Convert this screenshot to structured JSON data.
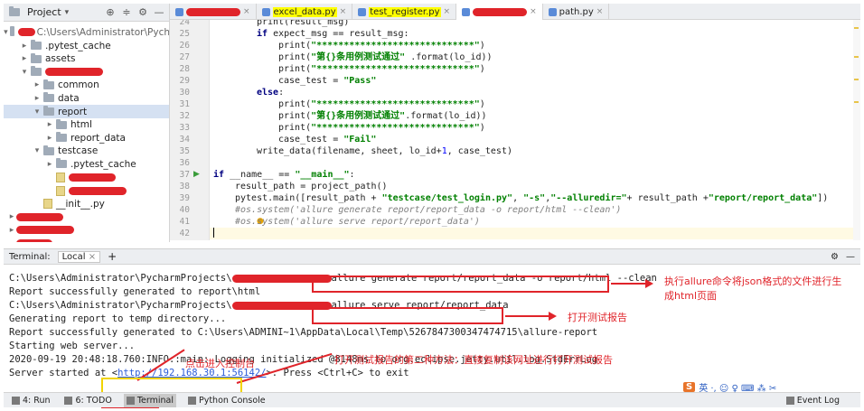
{
  "project_panel": {
    "title": "Project",
    "dropdown_glyph": "▾",
    "icons": [
      "target-icon",
      "collapse-icon",
      "gear-icon",
      "minimize-icon"
    ],
    "root_path": "C:\\Users\\Administrator\\Pych",
    "items": [
      {
        "label": ".pytest_cache",
        "indent": 1,
        "arrow": "▸",
        "icon": "folder"
      },
      {
        "label": "assets",
        "indent": 1,
        "arrow": "▸",
        "icon": "folder"
      },
      {
        "label": "",
        "indent": 1,
        "arrow": "▾",
        "icon": "folder",
        "redacted": true
      },
      {
        "label": "common",
        "indent": 2,
        "arrow": "▸",
        "icon": "folder"
      },
      {
        "label": "data",
        "indent": 2,
        "arrow": "▸",
        "icon": "folder"
      },
      {
        "label": "report",
        "indent": 2,
        "arrow": "▾",
        "icon": "folder",
        "selected": true
      },
      {
        "label": "html",
        "indent": 3,
        "arrow": "▸",
        "icon": "folder"
      },
      {
        "label": "report_data",
        "indent": 3,
        "arrow": "▸",
        "icon": "folder"
      },
      {
        "label": "testcase",
        "indent": 2,
        "arrow": "▾",
        "icon": "folder"
      },
      {
        "label": ".pytest_cache",
        "indent": 3,
        "arrow": "▸",
        "icon": "folder"
      },
      {
        "label": "",
        "indent": 3,
        "arrow": "",
        "icon": "file",
        "redacted": true
      },
      {
        "label": "",
        "indent": 3,
        "arrow": "",
        "icon": "file",
        "redacted": true
      },
      {
        "label": "__init__.py",
        "indent": 2,
        "arrow": "",
        "icon": "file"
      },
      {
        "label": "",
        "indent": 0,
        "arrow": "▸",
        "icon": "none",
        "redacted": true
      },
      {
        "label": "",
        "indent": 0,
        "arrow": "▸",
        "icon": "none",
        "redacted": true
      },
      {
        "label": "",
        "indent": 0,
        "arrow": "",
        "icon": "none",
        "redacted": true
      }
    ]
  },
  "editor_tabs": [
    {
      "label": "",
      "redacted": true,
      "active": false
    },
    {
      "label": "excel_data.py",
      "active": false,
      "highlight": true
    },
    {
      "label": "test_register.py",
      "active": false,
      "highlight": true
    },
    {
      "label": "",
      "redacted": true,
      "active": true
    },
    {
      "label": "path.py",
      "active": false
    }
  ],
  "code": {
    "first_line_number": 24,
    "current_line": 42,
    "run_marker_line": 37,
    "bulb_marker_line": 41,
    "lines": [
      {
        "indent": 8,
        "tokens": [
          {
            "t": "print(result_msg)",
            "c": ""
          }
        ]
      },
      {
        "indent": 8,
        "tokens": [
          {
            "t": "if",
            "c": "kw"
          },
          {
            "t": " expect_msg == result_msg:",
            "c": ""
          }
        ]
      },
      {
        "indent": 12,
        "tokens": [
          {
            "t": "print(",
            "c": ""
          },
          {
            "t": "\"*****************************\"",
            "c": "str"
          },
          {
            "t": ")",
            "c": ""
          }
        ]
      },
      {
        "indent": 12,
        "tokens": [
          {
            "t": "print(",
            "c": ""
          },
          {
            "t": "\"第{}条用例测试通过\"",
            "c": "str"
          },
          {
            "t": " .format(lo_id))",
            "c": ""
          }
        ]
      },
      {
        "indent": 12,
        "tokens": [
          {
            "t": "print(",
            "c": ""
          },
          {
            "t": "\"*****************************\"",
            "c": "str"
          },
          {
            "t": ")",
            "c": ""
          }
        ]
      },
      {
        "indent": 12,
        "tokens": [
          {
            "t": "case_test = ",
            "c": ""
          },
          {
            "t": "\"Pass\"",
            "c": "str"
          }
        ]
      },
      {
        "indent": 8,
        "tokens": [
          {
            "t": "else",
            "c": "kw"
          },
          {
            "t": ":",
            "c": ""
          }
        ]
      },
      {
        "indent": 12,
        "tokens": [
          {
            "t": "print(",
            "c": ""
          },
          {
            "t": "\"*****************************\"",
            "c": "str"
          },
          {
            "t": ")",
            "c": ""
          }
        ]
      },
      {
        "indent": 12,
        "tokens": [
          {
            "t": "print(",
            "c": ""
          },
          {
            "t": "\"第{}条用例测试通过\"",
            "c": "str"
          },
          {
            "t": ".format(lo_id))",
            "c": ""
          }
        ]
      },
      {
        "indent": 12,
        "tokens": [
          {
            "t": "print(",
            "c": ""
          },
          {
            "t": "\"*****************************\"",
            "c": "str"
          },
          {
            "t": ")",
            "c": ""
          }
        ]
      },
      {
        "indent": 12,
        "tokens": [
          {
            "t": "case_test = ",
            "c": ""
          },
          {
            "t": "\"Fail\"",
            "c": "str"
          }
        ]
      },
      {
        "indent": 8,
        "tokens": [
          {
            "t": "write_data(filename, sheet, lo_id+",
            "c": ""
          },
          {
            "t": "1",
            "c": "num"
          },
          {
            "t": ", case_test)",
            "c": ""
          }
        ]
      },
      {
        "indent": 0,
        "tokens": []
      },
      {
        "indent": 0,
        "tokens": [
          {
            "t": "if",
            "c": "kw"
          },
          {
            "t": " __name__ == ",
            "c": ""
          },
          {
            "t": "\"__main__\"",
            "c": "str"
          },
          {
            "t": ":",
            "c": ""
          }
        ]
      },
      {
        "indent": 4,
        "tokens": [
          {
            "t": "result_path = project_path()",
            "c": ""
          }
        ]
      },
      {
        "indent": 4,
        "tokens": [
          {
            "t": "pytest.main([result_path + ",
            "c": ""
          },
          {
            "t": "\"testcase/test_login.py\"",
            "c": "str"
          },
          {
            "t": ", ",
            "c": ""
          },
          {
            "t": "\"-s\"",
            "c": "str"
          },
          {
            "t": ",",
            "c": ""
          },
          {
            "t": "\"--alluredir=\"",
            "c": "str"
          },
          {
            "t": "+ result_path +",
            "c": ""
          },
          {
            "t": "\"report/report_data\"",
            "c": "str"
          },
          {
            "t": "])",
            "c": ""
          }
        ]
      },
      {
        "indent": 4,
        "tokens": [
          {
            "t": "#os.system('allure generate report/report_data -o report/html --clean')",
            "c": "com"
          }
        ]
      },
      {
        "indent": 4,
        "tokens": [
          {
            "t": "#os.system('allure serve report/report_data')",
            "c": "com"
          }
        ]
      },
      {
        "indent": 0,
        "tokens": []
      }
    ]
  },
  "terminal": {
    "tab_label": "Terminal:",
    "session_label": "Local",
    "close_glyph": "×",
    "add_glyph": "+",
    "settings_glyph": "⚙",
    "minimize_glyph": "—",
    "lines": [
      {
        "pre": "C:\\Users\\Administrator\\PycharmProjects\\",
        "redact_w": 110,
        "post": "allure generate report/report_data -o report/html --clean"
      },
      {
        "pre": "Report successfully generated to report\\html",
        "redact_w": 0,
        "post": ""
      },
      {
        "pre": "C:\\Users\\Administrator\\PycharmProjects\\",
        "redact_w": 110,
        "post": "allure serve report/report_data"
      },
      {
        "pre": "Generating report to temp directory...",
        "redact_w": 0,
        "post": ""
      },
      {
        "pre": "Report successfully generated to C:\\Users\\ADMINI~1\\AppData\\Local\\Temp\\5267847300347474715\\allure-report",
        "redact_w": 0,
        "post": ""
      },
      {
        "pre": "Starting web server...",
        "redact_w": 0,
        "post": ""
      },
      {
        "pre": "2020-09-19 20:48:18.760:INFO::main: Logging initialized @8148ms to org.eclipse.jetty.util.log.StdErrLog",
        "redact_w": 0,
        "post": ""
      },
      {
        "pre": "Server started at <",
        "link": "http://192.168.30.1:56142/",
        "post": ">. Press <Ctrl+C> to exit"
      }
    ]
  },
  "annotations": {
    "generate": "执行allure命令将json格式的文件进行生\n成html页面",
    "serve": "打开测试报告",
    "console": "点击进入控制台",
    "second_way": "打开测试报告的第二种方法：直接复制该网址进行打开测试报告"
  },
  "bottom_bar": {
    "items": [
      {
        "label": "4: Run",
        "active": false,
        "icon": "run-icon"
      },
      {
        "label": "6: TODO",
        "active": false,
        "icon": "todo-icon"
      },
      {
        "label": "Terminal",
        "active": true,
        "icon": "terminal-icon"
      },
      {
        "label": "Python Console",
        "active": false,
        "icon": "python-console-icon"
      }
    ],
    "event_log": "Event Log"
  },
  "ime_bar": {
    "logo": "S",
    "text": "英 ·, ☺ ♀ ⌨ ⁂ ✂"
  },
  "colors": {
    "annotation_red": "#e0242a",
    "highlight_yellow": "#ffff00",
    "link_blue": "#2a5bd8"
  }
}
